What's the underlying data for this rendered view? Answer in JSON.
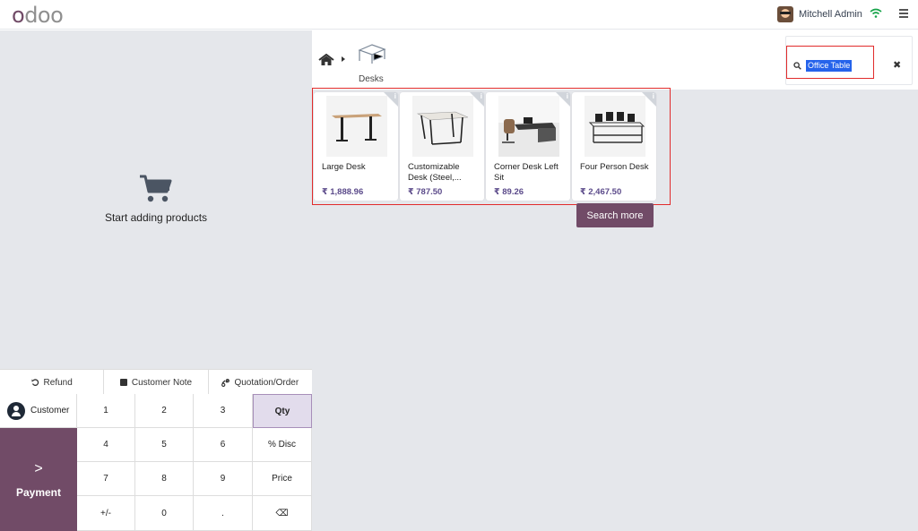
{
  "topbar": {
    "logo": "odoo",
    "user_name": "Mitchell Admin"
  },
  "cart": {
    "empty_text": "Start adding products"
  },
  "actions": {
    "refund": "Refund",
    "customer_note": "Customer Note",
    "quotation": "Quotation/Order"
  },
  "pad": {
    "customer": "Customer",
    "payment": "Payment",
    "keys": [
      "1",
      "2",
      "3",
      "Qty",
      "4",
      "5",
      "6",
      "% Disc",
      "7",
      "8",
      "9",
      "Price",
      "+/-",
      "0",
      ".",
      "⌫"
    ]
  },
  "breadcrumb": {
    "category": "Desks"
  },
  "search": {
    "value": "Office Table"
  },
  "products": [
    {
      "name": "Large Desk",
      "price": "₹ 1,888.96"
    },
    {
      "name": "Customizable Desk (Steel,...",
      "price": "₹ 787.50"
    },
    {
      "name": "Corner Desk Left Sit",
      "price": "₹ 89.26"
    },
    {
      "name": "Four Person Desk",
      "price": "₹ 2,467.50"
    }
  ],
  "search_more": "Search more",
  "colors": {
    "brand": "#714B67",
    "price": "#5b4a8a",
    "highlight": "#e12b2b"
  }
}
